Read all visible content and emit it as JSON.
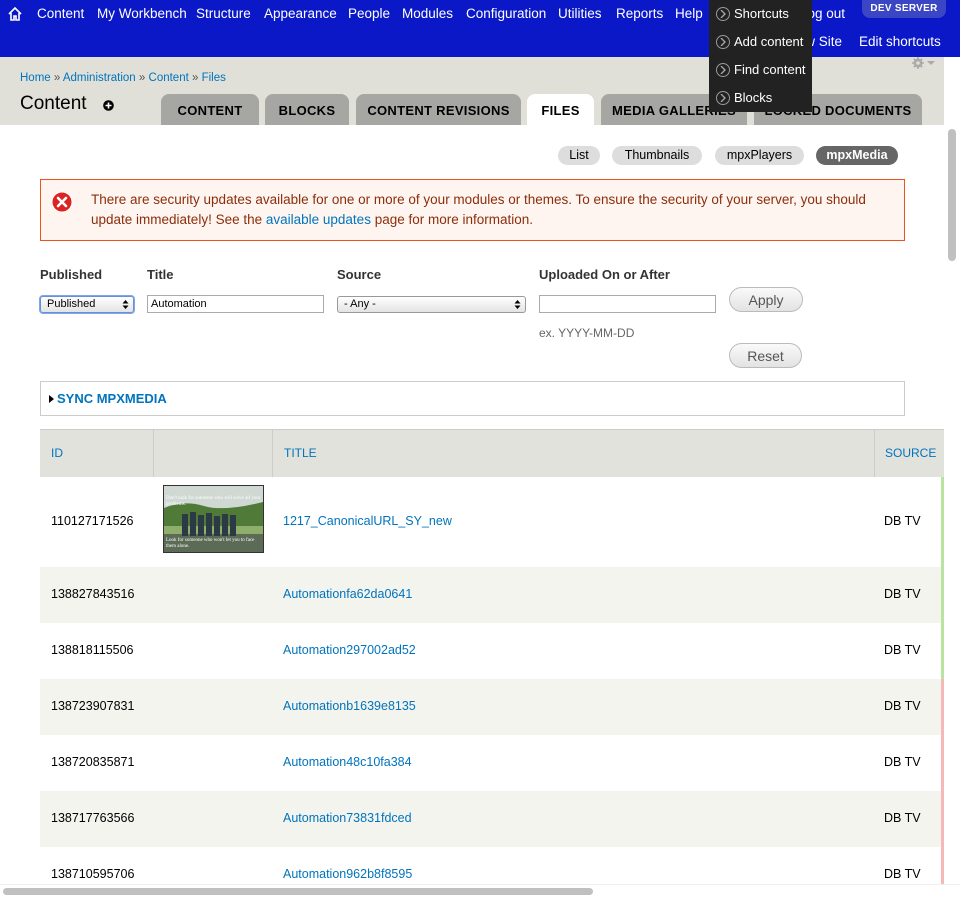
{
  "toolbar": {
    "menu": [
      "Content",
      "My Workbench",
      "Structure",
      "Appearance",
      "People",
      "Modules",
      "Configuration",
      "Utilities",
      "Reports",
      "Help"
    ],
    "logout": "Log out",
    "env_badge": "DEV SERVER",
    "view_site": "View Site",
    "edit_shortcuts": "Edit shortcuts",
    "bg_color": "#0a18c8"
  },
  "shortcuts_menu": {
    "items": [
      "Shortcuts",
      "Add content",
      "Find content",
      "Blocks"
    ]
  },
  "breadcrumb": [
    "Home",
    "Administration",
    "Content",
    "Files"
  ],
  "page_title": "Content",
  "tabs": [
    "CONTENT",
    "BLOCKS",
    "CONTENT REVISIONS",
    "FILES",
    "MEDIA GALLERIES",
    "LOCKED DOCUMENTS"
  ],
  "active_tab": "FILES",
  "secondary_tabs": [
    "List",
    "Thumbnails",
    "mpxPlayers",
    "mpxMedia"
  ],
  "active_secondary_tab": "mpxMedia",
  "message": {
    "text_before": "There are security updates available for one or more of your modules or themes. To ensure the security of your server, you should update immediately! See the ",
    "link": "available updates",
    "text_after": " page for more information."
  },
  "filters": {
    "published_label": "Published",
    "published_value": "Published",
    "title_label": "Title",
    "title_value": "Automation",
    "source_label": "Source",
    "source_value": "- Any -",
    "uploaded_label": "Uploaded On or After",
    "uploaded_value": "",
    "date_hint": "ex. YYYY-MM-DD",
    "apply": "Apply",
    "reset": "Reset"
  },
  "fieldset_legend": "SYNC MPXMEDIA",
  "table": {
    "headers": [
      "ID",
      "TITLE",
      "SOURCE"
    ],
    "rows": [
      {
        "id": "110127171526",
        "title": "1217_CanonicalURL_SY_new",
        "source": "DB TV",
        "thumb": true,
        "status": "green"
      },
      {
        "id": "138827843516",
        "title": "Automationfa62da0641",
        "source": "DB TV",
        "status": "green"
      },
      {
        "id": "138818115506",
        "title": "Automation297002ad52",
        "source": "DB TV",
        "status": "green"
      },
      {
        "id": "138723907831",
        "title": "Automationb1639e8135",
        "source": "DB TV",
        "status": "red"
      },
      {
        "id": "138720835871",
        "title": "Automation48c10fa384",
        "source": "DB TV",
        "status": "red"
      },
      {
        "id": "138717763566",
        "title": "Automation73831fdced",
        "source": "DB TV",
        "status": "red"
      },
      {
        "id": "138710595706",
        "title": "Automation962b8f8595",
        "source": "DB TV",
        "status": "red"
      }
    ],
    "thumb_caption_top": "Don't look for someone who will solve all your problems.",
    "thumb_caption_bottom": "Look for someone who won't let you to face them alone."
  }
}
